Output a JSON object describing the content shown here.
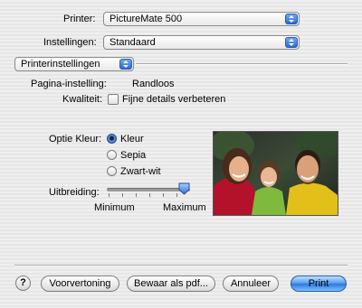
{
  "printer": {
    "label": "Printer:",
    "value": "PictureMate 500"
  },
  "presets": {
    "label": "Instellingen:",
    "value": "Standaard"
  },
  "panel": {
    "value": "Printerinstellingen"
  },
  "page_setup": {
    "label": "Pagina-instelling:",
    "value": "Randloos"
  },
  "quality": {
    "label": "Kwaliteit:",
    "checkbox_label": "Fijne details verbeteren",
    "checked": false
  },
  "color_option": {
    "label": "Optie Kleur:",
    "options": [
      "Kleur",
      "Sepia",
      "Zwart-wit"
    ],
    "selected": "Kleur"
  },
  "expansion": {
    "label": "Uitbreiding:",
    "min_label": "Minimum",
    "max_label": "Maximum",
    "level": 1.0
  },
  "buttons": {
    "help": "?",
    "preview": "Voorvertoning",
    "save_pdf": "Bewaar als pdf...",
    "cancel": "Annuleer",
    "print": "Print"
  },
  "colors": {
    "accent": "#2f79e0",
    "background": "#ececec"
  }
}
